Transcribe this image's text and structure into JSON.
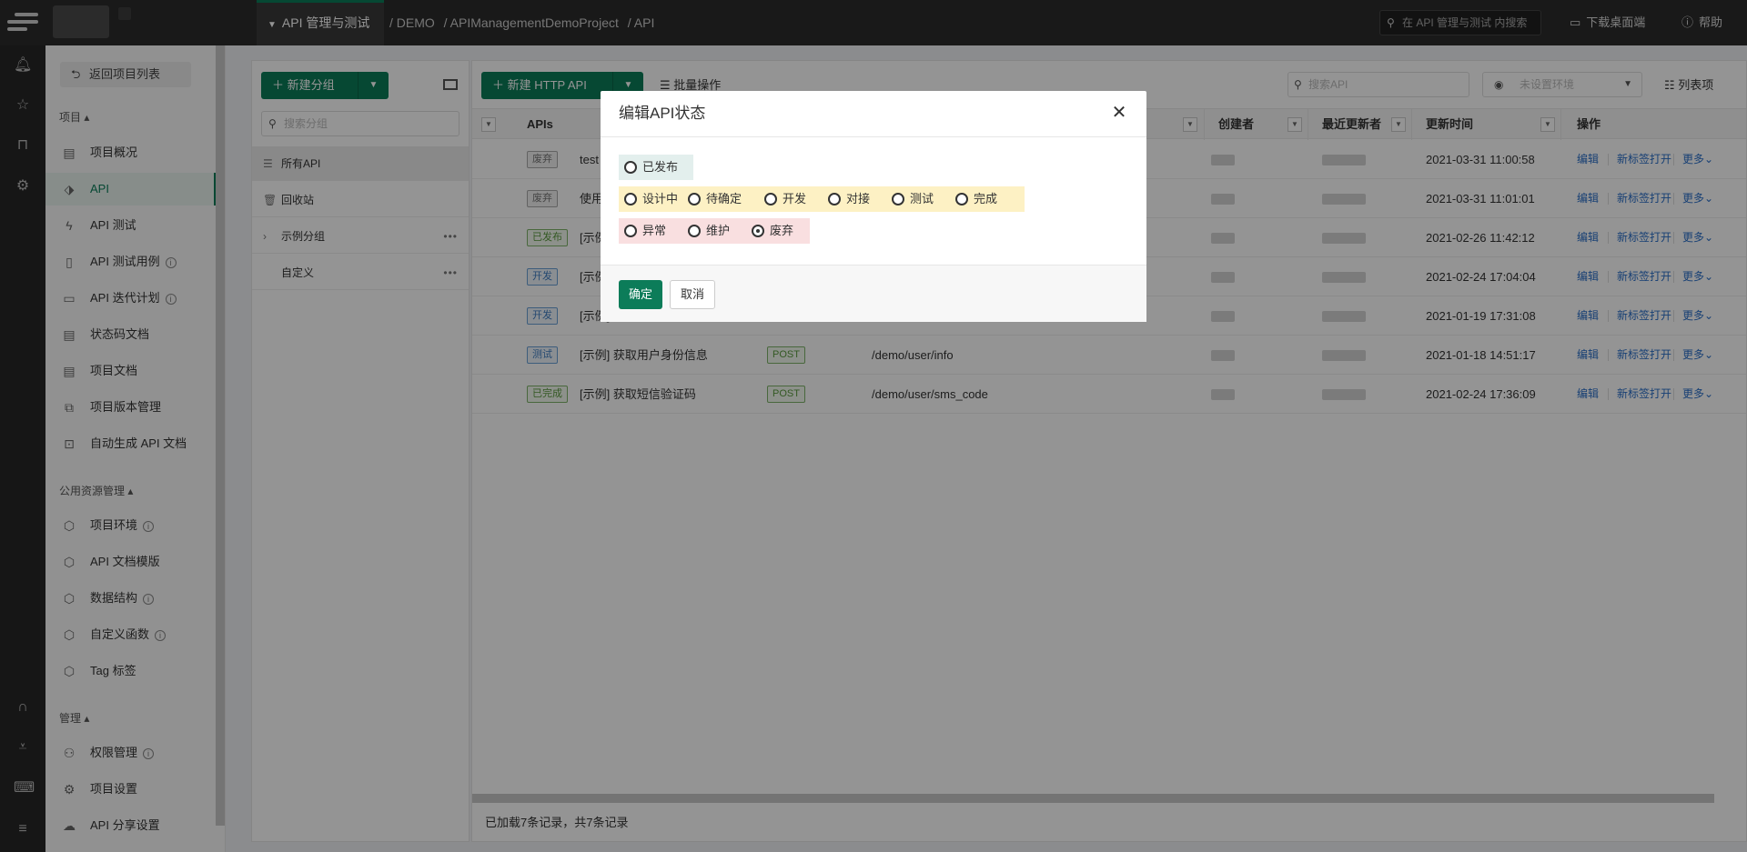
{
  "topbar": {
    "module": "API 管理与测试",
    "breadcrumb": [
      "/ DEMO",
      "/ APIManagementDemoProject",
      "/ API"
    ],
    "search_placeholder": "在 API 管理与测试 内搜索",
    "download_label": "下载桌面端",
    "help_label": "帮助"
  },
  "sidebar": {
    "back_label": "返回项目列表",
    "section_project": "项目 ▴",
    "items_project": [
      {
        "label": "项目概况",
        "icon": "overview-icon"
      },
      {
        "label": "API",
        "icon": "api-icon"
      },
      {
        "label": "API 测试",
        "icon": "lightning-icon"
      },
      {
        "label": "API 测试用例",
        "icon": "testcase-icon"
      },
      {
        "label": "API 迭代计划",
        "icon": "plan-icon"
      },
      {
        "label": "状态码文档",
        "icon": "doc-icon"
      },
      {
        "label": "项目文档",
        "icon": "doc-icon"
      },
      {
        "label": "项目版本管理",
        "icon": "version-icon"
      },
      {
        "label": "自动生成 API 文档",
        "icon": "robot-icon"
      }
    ],
    "section_resource": "公用资源管理 ▴",
    "items_resource": [
      {
        "label": "项目环境",
        "icon": "cube-icon"
      },
      {
        "label": "API 文档模版",
        "icon": "cube-icon"
      },
      {
        "label": "数据结构",
        "icon": "cube-icon"
      },
      {
        "label": "自定义函数",
        "icon": "cube-icon"
      },
      {
        "label": "Tag 标签",
        "icon": "cube-icon"
      }
    ],
    "section_manage": "管理 ▴",
    "items_manage": [
      {
        "label": "权限管理",
        "icon": "user-icon"
      },
      {
        "label": "项目设置",
        "icon": "gear-icon"
      },
      {
        "label": "API 分享设置",
        "icon": "cloud-icon"
      }
    ]
  },
  "groups": {
    "new_group_label": "新建分组",
    "search_placeholder": "搜索分组",
    "items": [
      {
        "label": "所有API"
      },
      {
        "label": "回收站"
      },
      {
        "label": "示例分组"
      },
      {
        "label": "自定义"
      }
    ]
  },
  "toolbar": {
    "new_api_label": "新建 HTTP API",
    "batch_label": "批量操作",
    "api_search_placeholder": "搜索API",
    "env_placeholder": "未设置环境",
    "view_label": "列表项"
  },
  "table": {
    "headers": {
      "apis": "APIs",
      "creator": "创建者",
      "updater": "最近更新者",
      "updated": "更新时间",
      "actions": "操作"
    },
    "rows": [
      {
        "status": "废弃",
        "name": "test",
        "method": "",
        "url": "",
        "time": "2021-03-31 11:00:58"
      },
      {
        "status": "废弃",
        "name": "使用",
        "method": "",
        "url": "",
        "time": "2021-03-31 11:01:01"
      },
      {
        "status": "已发布",
        "name": "[示例]",
        "method": "",
        "url": "",
        "time": "2021-02-26 11:42:12"
      },
      {
        "status": "开发",
        "name": "[示例]",
        "method": "",
        "url": "",
        "time": "2021-02-24 17:04:04"
      },
      {
        "status": "开发",
        "name": "[示例]",
        "method": "",
        "url": "",
        "time": "2021-01-19 17:31:08"
      },
      {
        "status": "测试",
        "name": "[示例] 获取用户身份信息",
        "method": "POST",
        "url": "/demo/user/info",
        "time": "2021-01-18 14:51:17"
      },
      {
        "status": "已完成",
        "name": "[示例] 获取短信验证码",
        "method": "POST",
        "url": "/demo/user/sms_code",
        "time": "2021-02-24 17:36:09"
      }
    ],
    "action_labels": {
      "edit": "编辑",
      "open_tab": "新标签打开",
      "more": "更多"
    },
    "footer": "已加载7条记录，共7条记录"
  },
  "modal": {
    "title": "编辑API状态",
    "options": {
      "published": "已发布",
      "designing": "设计中",
      "pending": "待确定",
      "developing": "开发",
      "integrating": "对接",
      "testing": "测试",
      "done": "完成",
      "abnormal": "异常",
      "maintaining": "维护",
      "deprecated": "废弃"
    },
    "selected": "deprecated",
    "confirm_label": "确定",
    "cancel_label": "取消"
  }
}
